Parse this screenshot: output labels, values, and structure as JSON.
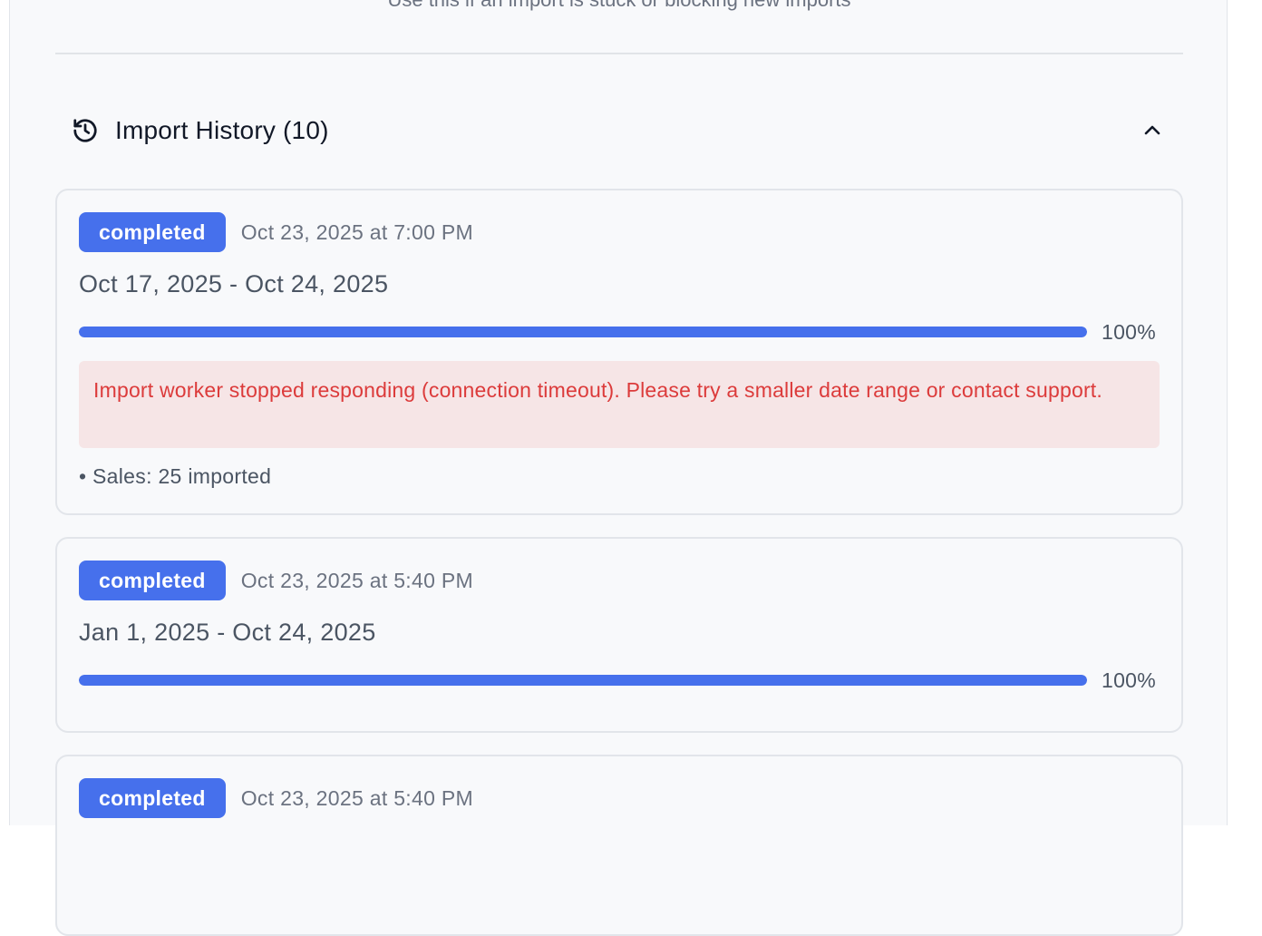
{
  "helper_text": "Use this if an import is stuck or blocking new imports",
  "history": {
    "title": "Import History (10)",
    "icon": "history-icon",
    "collapse_icon": "chevron-up-icon"
  },
  "colors": {
    "accent": "#4670ec",
    "error_text": "#dc3b3b",
    "error_bg": "#f6e5e6"
  },
  "imports": [
    {
      "status": "completed",
      "timestamp": "Oct 23, 2025 at 7:00 PM",
      "range": "Oct 17, 2025 - Oct 24, 2025",
      "progress": 100,
      "progress_label": "100%",
      "error": "Import worker stopped responding (connection timeout). Please try a smaller date range or contact support.",
      "stat": "• Sales: 25 imported"
    },
    {
      "status": "completed",
      "timestamp": "Oct 23, 2025 at 5:40 PM",
      "range": "Jan 1, 2025 - Oct 24, 2025",
      "progress": 100,
      "progress_label": "100%"
    },
    {
      "status": "completed",
      "timestamp": "Oct 23, 2025 at 5:40 PM"
    }
  ]
}
